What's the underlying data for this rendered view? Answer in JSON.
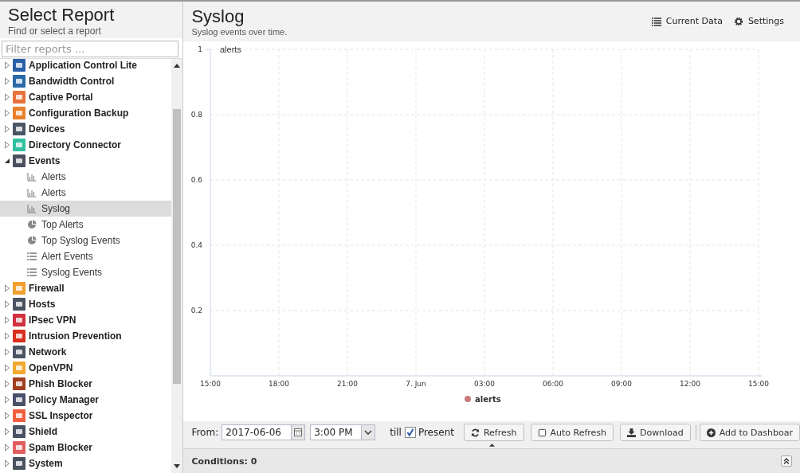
{
  "sidebar": {
    "title": "Select Report",
    "subtitle": "Find or select a report",
    "filter": {
      "placeholder": "Filter reports ..."
    },
    "items": [
      {
        "label": "Application Control Lite",
        "color": "#2a5fa8",
        "expanded": false
      },
      {
        "label": "Bandwidth Control",
        "color": "#2a6aa8",
        "expanded": false
      },
      {
        "label": "Captive Portal",
        "color": "#e8733a",
        "expanded": false
      },
      {
        "label": "Configuration Backup",
        "color": "#e8802a",
        "expanded": false
      },
      {
        "label": "Devices",
        "color": "#4a5566",
        "expanded": false
      },
      {
        "label": "Directory Connector",
        "color": "#30c0a0",
        "expanded": false
      },
      {
        "label": "Events",
        "color": "#4a5060",
        "expanded": true,
        "children": [
          {
            "label": "Alerts",
            "kind": "bar",
            "selected": false
          },
          {
            "label": "Alerts",
            "kind": "bar",
            "selected": false
          },
          {
            "label": "Syslog",
            "kind": "bar",
            "selected": true
          },
          {
            "label": "Top Alerts",
            "kind": "pie",
            "selected": false
          },
          {
            "label": "Top Syslog Events",
            "kind": "pie",
            "selected": false
          },
          {
            "label": "Alert Events",
            "kind": "list",
            "selected": false
          },
          {
            "label": "Syslog Events",
            "kind": "list",
            "selected": false
          }
        ]
      },
      {
        "label": "Firewall",
        "color": "#f0a030",
        "expanded": false
      },
      {
        "label": "Hosts",
        "color": "#4a5262",
        "expanded": false
      },
      {
        "label": "IPsec VPN",
        "color": "#d03040",
        "expanded": false
      },
      {
        "label": "Intrusion Prevention",
        "color": "#d83020",
        "expanded": false
      },
      {
        "label": "Network",
        "color": "#4a5464",
        "expanded": false
      },
      {
        "label": "OpenVPN",
        "color": "#f0a830",
        "expanded": false
      },
      {
        "label": "Phish Blocker",
        "color": "#a04020",
        "expanded": false
      },
      {
        "label": "Policy Manager",
        "color": "#4a5068",
        "expanded": false
      },
      {
        "label": "SSL Inspector",
        "color": "#f06040",
        "expanded": false
      },
      {
        "label": "Shield",
        "color": "#4a5266",
        "expanded": false
      },
      {
        "label": "Spam Blocker",
        "color": "#e06060",
        "expanded": false
      },
      {
        "label": "System",
        "color": "#4a5460",
        "expanded": false
      }
    ]
  },
  "report": {
    "title": "Syslog",
    "subtitle": "Syslog events over time.",
    "actions": [
      {
        "label": "Current Data",
        "kind": "list"
      },
      {
        "label": "Settings",
        "kind": "gear"
      }
    ],
    "chart_data": {
      "type": "line",
      "grid": true,
      "categories": [
        "15:00",
        "18:00",
        "21:00",
        "7. Jun",
        "03:00",
        "06:00",
        "09:00",
        "12:00",
        "15:00"
      ],
      "ylim": [
        0,
        1
      ],
      "yticks": [
        0.2,
        0.4,
        0.6,
        0.8,
        1
      ],
      "series": [
        {
          "name": "alerts",
          "color": "#c87a7a",
          "values": [
            null,
            null,
            null,
            null,
            null,
            null,
            null,
            null,
            null
          ]
        }
      ]
    }
  },
  "toolbar": {
    "from_label": "From:",
    "date": "2017-06-06",
    "time": "3:00 PM",
    "till_label": "till",
    "present": {
      "label": "Present",
      "checked": true
    },
    "buttons": [
      {
        "label": "Refresh",
        "kind": "refresh"
      },
      {
        "label": "Auto Refresh",
        "kind": "check"
      },
      {
        "label": "Download",
        "kind": "download"
      },
      {
        "label": "Add to Dashboar",
        "kind": "add"
      }
    ]
  },
  "conditions": {
    "label": "Conditions: 0"
  }
}
